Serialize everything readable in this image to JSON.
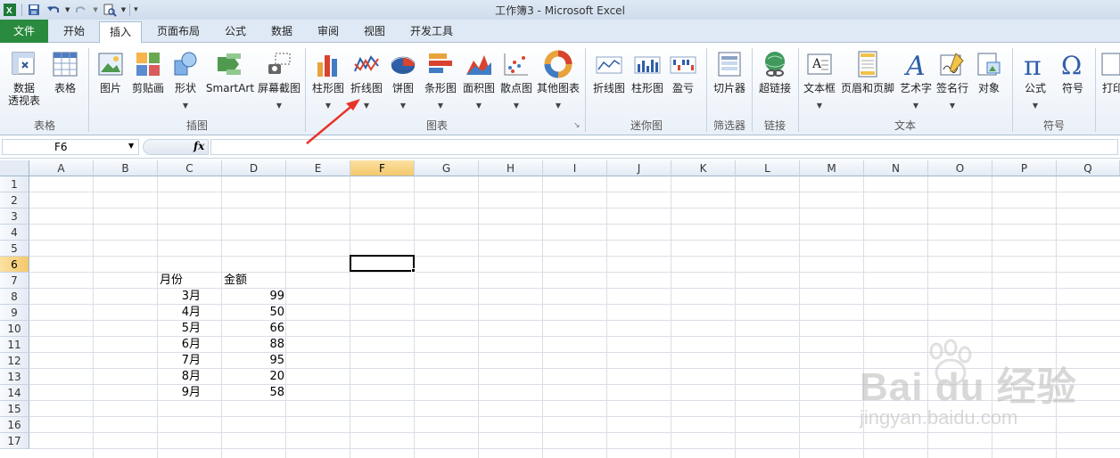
{
  "window": {
    "title": "工作簿3 - Microsoft Excel"
  },
  "tabs": [
    {
      "label": "文件"
    },
    {
      "label": "开始"
    },
    {
      "label": "插入"
    },
    {
      "label": "页面布局"
    },
    {
      "label": "公式"
    },
    {
      "label": "数据"
    },
    {
      "label": "审阅"
    },
    {
      "label": "视图"
    },
    {
      "label": "开发工具"
    }
  ],
  "ribbon": {
    "buttons": [
      {
        "label": "数据\n透视表",
        "icon": "pivot-table-icon"
      },
      {
        "label": "表格",
        "icon": "table-icon"
      },
      {
        "label": "图片",
        "icon": "picture-icon"
      },
      {
        "label": "剪贴画",
        "icon": "clipart-icon"
      },
      {
        "label": "形状",
        "icon": "shapes-icon"
      },
      {
        "label": "SmartArt",
        "icon": "smartart-icon"
      },
      {
        "label": "屏幕截图",
        "icon": "screenshot-icon"
      },
      {
        "label": "柱形图",
        "icon": "column-chart-icon"
      },
      {
        "label": "折线图",
        "icon": "line-chart-icon"
      },
      {
        "label": "饼图",
        "icon": "pie-chart-icon"
      },
      {
        "label": "条形图",
        "icon": "bar-chart-icon"
      },
      {
        "label": "面积图",
        "icon": "area-chart-icon"
      },
      {
        "label": "散点图",
        "icon": "scatter-chart-icon"
      },
      {
        "label": "其他图表",
        "icon": "other-chart-icon"
      },
      {
        "label": "折线图",
        "icon": "sparkline-line-icon"
      },
      {
        "label": "柱形图",
        "icon": "sparkline-column-icon"
      },
      {
        "label": "盈亏",
        "icon": "sparkline-winloss-icon"
      },
      {
        "label": "切片器",
        "icon": "slicer-icon"
      },
      {
        "label": "超链接",
        "icon": "hyperlink-icon"
      },
      {
        "label": "文本框",
        "icon": "textbox-icon"
      },
      {
        "label": "页眉和页脚",
        "icon": "header-footer-icon"
      },
      {
        "label": "艺术字",
        "icon": "wordart-icon"
      },
      {
        "label": "签名行",
        "icon": "signature-icon"
      },
      {
        "label": "对象",
        "icon": "object-icon"
      },
      {
        "label": "公式",
        "icon": "equation-icon"
      },
      {
        "label": "符号",
        "icon": "symbol-icon"
      },
      {
        "label": "打印",
        "icon": "print-icon"
      }
    ],
    "groups": [
      "表格",
      "插图",
      "图表",
      "迷你图",
      "筛选器",
      "链接",
      "文本",
      "符号"
    ]
  },
  "formula_bar": {
    "name_box": "F6",
    "fx": "fx",
    "value": ""
  },
  "sheet": {
    "columns": [
      "A",
      "B",
      "C",
      "D",
      "E",
      "F",
      "G",
      "H",
      "I",
      "J",
      "K",
      "L",
      "M",
      "N",
      "O",
      "P",
      "Q"
    ],
    "rows": [
      "1",
      "2",
      "3",
      "4",
      "5",
      "6",
      "7",
      "8",
      "9",
      "10",
      "11",
      "12",
      "13",
      "14",
      "15",
      "16",
      "17"
    ],
    "header": {
      "month": "月份",
      "amount": "金额"
    },
    "data": [
      {
        "month": "3月",
        "amount": "99"
      },
      {
        "month": "4月",
        "amount": "50"
      },
      {
        "month": "5月",
        "amount": "66"
      },
      {
        "month": "6月",
        "amount": "88"
      },
      {
        "month": "7月",
        "amount": "95"
      },
      {
        "month": "8月",
        "amount": "20"
      },
      {
        "month": "9月",
        "amount": "58"
      }
    ]
  },
  "watermark": {
    "main": "Bai du 经验",
    "sub": "jingyan.baidu.com"
  },
  "colors": {
    "file_tab": "#2a8a3e",
    "selection_header": "#f5c86b",
    "annotation_arrow": "#e8332a"
  }
}
